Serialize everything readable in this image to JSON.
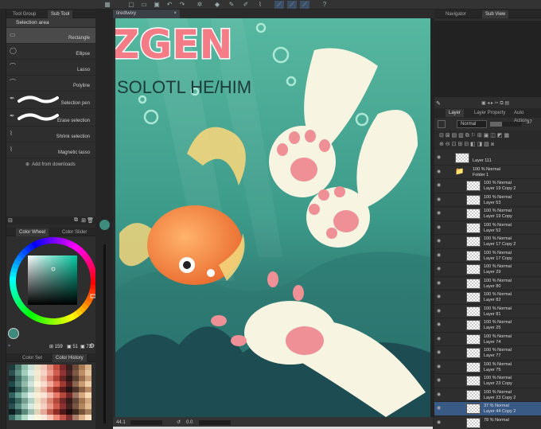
{
  "tool_panel": {
    "tabs": [
      "Tool Group",
      "Sub Tool"
    ],
    "header": "Selection area",
    "tools": [
      {
        "label": "Rectangle",
        "icon": "rectangle-select-icon",
        "selected": true
      },
      {
        "label": "Ellipse",
        "icon": "ellipse-select-icon"
      },
      {
        "label": "Lasso",
        "icon": "lasso-icon"
      },
      {
        "label": "Polyline",
        "icon": "polyline-icon"
      },
      {
        "label": "Selection pen",
        "icon": "selection-pen-icon"
      },
      {
        "label": "Erase selection",
        "icon": "erase-selection-icon"
      },
      {
        "label": "Shrink selection",
        "icon": "shrink-selection-icon"
      },
      {
        "label": "Magnetic lasso",
        "icon": "magnetic-lasso-icon"
      }
    ],
    "add_downloads": "Add from downloads"
  },
  "color_panel": {
    "tabs": [
      "Color Wheel",
      "Color Slider"
    ],
    "h": "159",
    "s": "51",
    "v": "72",
    "main_color": "#3e8a7c"
  },
  "color_history": {
    "tabs": [
      "Color Set",
      "Color History"
    ],
    "swatches": [
      "#1f3a3a",
      "#4d7a6e",
      "#8fbfae",
      "#c9e0d6",
      "#e8e0c8",
      "#f2c7b8",
      "#e08a7a",
      "#c24d3f",
      "#7a2a2a",
      "#3b2020",
      "#6b4a3a",
      "#a87a55",
      "#d9b48a",
      "#2d4f4f",
      "#5e8f80",
      "#a3cdbd",
      "#dcefe6",
      "#f4ead2",
      "#f7d3c6",
      "#eb9e8d",
      "#d15f50",
      "#8f3535",
      "#4a2626",
      "#7d5a46",
      "#bb8e66",
      "#e6c49b",
      "#1a2e30",
      "#3f6b63",
      "#79a898",
      "#b7d6c9",
      "#efe6cc",
      "#f0bdae",
      "#d77868",
      "#b03e33",
      "#6a2323",
      "#2e1818",
      "#5c4030",
      "#996e4c",
      "#cca27a",
      "#22494a",
      "#507e72",
      "#92bba9",
      "#cfe5db",
      "#fff4dc",
      "#f9dcd0",
      "#f2ab9b",
      "#e06c5c",
      "#a13b32",
      "#552020",
      "#8a6650",
      "#c79a70",
      "#f0d0a8",
      "#0f2626",
      "#2f5852",
      "#6a9886",
      "#aacbbd",
      "#e6dcc0",
      "#ecb3a3",
      "#cc6b5c",
      "#9c3329",
      "#5e1c1c",
      "#261414",
      "#4d3427",
      "#876043",
      "#b88d66",
      "#33605d",
      "#68a090",
      "#a8d3c2",
      "#e3f3ec",
      "#fbf0d6",
      "#fbe3d8",
      "#f6b8a8",
      "#e77a6a",
      "#b7483d",
      "#6f2929",
      "#9a7460",
      "#d4a77f",
      "#fadab5",
      "#17383a",
      "#3a665e",
      "#749f8f",
      "#b1d1c4",
      "#ebe2c6",
      "#eec0b2",
      "#d9826f",
      "#b54839",
      "#722828",
      "#361b1b",
      "#64473a",
      "#a07552",
      "#d2a981",
      "#284e50",
      "#578a7e",
      "#98c2b2",
      "#d5eae0",
      "#f7edd4",
      "#f5d0c3",
      "#ea9a88",
      "#cd5a4a",
      "#8c3232",
      "#452323",
      "#775644",
      "#b4875f",
      "#e0bc91",
      "#0c1e20",
      "#274a46",
      "#5c8a7a",
      "#9cc0b1",
      "#dfd4b8",
      "#e4a896",
      "#c25f50",
      "#8f2d24",
      "#511818",
      "#1f1010",
      "#3f2b20",
      "#76543a",
      "#a57f5c",
      "#3a6966",
      "#73ab9b",
      "#b3dccb",
      "#eaf7f1",
      "#fdf5de",
      "#fde9df",
      "#f9c3b4",
      "#ee8676",
      "#c55448",
      "#7d3030",
      "#a67e69",
      "#ddb289",
      "#ffe2c0"
    ]
  },
  "navigator": {
    "tabs": [
      "Navigator",
      "Sub View"
    ]
  },
  "document": {
    "title": "tiredtwixy"
  },
  "artwork": {
    "title_text": "ZGEN",
    "subtitle_text": "SOLOTL HE/HIM"
  },
  "status": {
    "zoom": "44.1",
    "angle": "0.0"
  },
  "layer_panel": {
    "tabs": [
      "Layer",
      "Layer Property",
      "Auto Action"
    ],
    "blend_mode": "Normal",
    "opacity": "37",
    "layers": [
      {
        "l1": "",
        "l2": "Layer 111",
        "indent": 0,
        "type": "layer"
      },
      {
        "l1": "100 % Normal",
        "l2": "Folder 1",
        "indent": 0,
        "type": "folder"
      },
      {
        "l1": "100 % Normal",
        "l2": "Layer 19 Copy 2",
        "indent": 1,
        "type": "layer"
      },
      {
        "l1": "100 % Normal",
        "l2": "Layer 53",
        "indent": 1,
        "type": "layer"
      },
      {
        "l1": "100 % Normal",
        "l2": "Layer 19 Copy",
        "indent": 1,
        "type": "layer"
      },
      {
        "l1": "100 % Normal",
        "l2": "Layer 52",
        "indent": 1,
        "type": "layer"
      },
      {
        "l1": "100 % Normal",
        "l2": "Layer 17 Copy 2",
        "indent": 1,
        "type": "layer"
      },
      {
        "l1": "100 % Normal",
        "l2": "Layer 17 Copy",
        "indent": 1,
        "type": "layer"
      },
      {
        "l1": "100 % Normal",
        "l2": "Layer 29",
        "indent": 1,
        "type": "layer"
      },
      {
        "l1": "100 % Normal",
        "l2": "Layer 80",
        "indent": 1,
        "type": "layer",
        "mark": true
      },
      {
        "l1": "100 % Normal",
        "l2": "Layer 82",
        "indent": 1,
        "type": "layer",
        "mark": true
      },
      {
        "l1": "100 % Normal",
        "l2": "Layer 81",
        "indent": 1,
        "type": "layer",
        "mark": true
      },
      {
        "l1": "100 % Normal",
        "l2": "Layer 25",
        "indent": 1,
        "type": "layer"
      },
      {
        "l1": "100 % Normal",
        "l2": "Layer 74",
        "indent": 1,
        "type": "layer",
        "mark": true
      },
      {
        "l1": "100 % Normal",
        "l2": "Layer 77",
        "indent": 1,
        "type": "layer",
        "mark": true
      },
      {
        "l1": "100 % Normal",
        "l2": "Layer 75",
        "indent": 1,
        "type": "layer",
        "mark": true
      },
      {
        "l1": "100 % Normal",
        "l2": "Layer 23 Copy",
        "indent": 1,
        "type": "layer"
      },
      {
        "l1": "100 % Normal",
        "l2": "Layer 23 Copy 2",
        "indent": 1,
        "type": "layer"
      },
      {
        "l1": "37 % Normal",
        "l2": "Layer 44 Copy 2",
        "indent": 1,
        "type": "layer",
        "selected": true
      },
      {
        "l1": "78 % Normal",
        "l2": "",
        "indent": 1,
        "type": "layer"
      }
    ]
  }
}
